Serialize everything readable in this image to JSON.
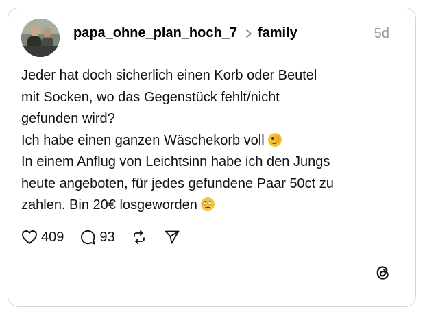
{
  "post": {
    "username": "papa_ohne_plan_hoch_7",
    "topic": "family",
    "time": "5d",
    "lines": [
      "Jeder hat doch sicherlich einen Korb oder Beutel",
      "mit Socken, wo das Gegenstück fehlt/nicht",
      "gefunden wird?",
      "Ich habe einen ganzen Wäschekorb voll",
      "In einem Anflug von Leichtsinn habe ich den Jungs",
      "heute angeboten, für jedes gefundene Paar 50ct zu",
      "zahlen. Bin 20€ losgeworden"
    ],
    "emojis": {
      "line4": "face-with-peeking-eye",
      "line7": "face-with-rolling-eyes"
    }
  },
  "actions": {
    "likes": "409",
    "comments": "93"
  },
  "icons": {
    "like": "heart-icon",
    "comment": "comment-bubble-icon",
    "repost": "repost-icon",
    "share": "share-send-icon",
    "brand": "threads-logo-icon"
  },
  "colors": {
    "border": "#d6d6d6",
    "time": "#9a9a9a",
    "emoji": "#f5c33b"
  }
}
